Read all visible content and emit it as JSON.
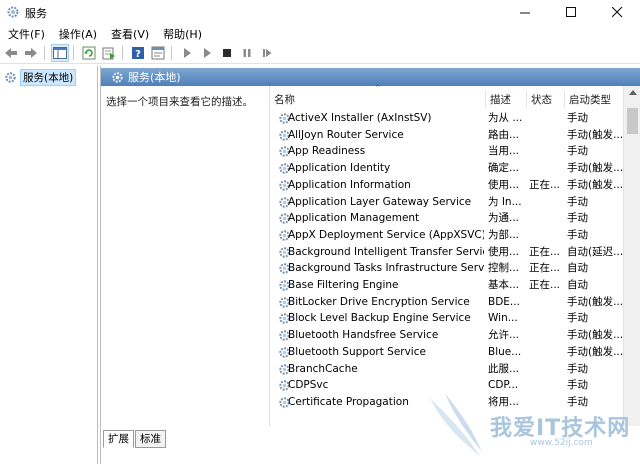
{
  "window": {
    "title": "服务"
  },
  "menu": [
    "文件(F)",
    "操作(A)",
    "查看(V)",
    "帮助(H)"
  ],
  "toolbar": [
    "back-arrow-icon",
    "forward-arrow-icon",
    "sep",
    "show-hide-tree-icon",
    "sep",
    "refresh-icon",
    "export-list-icon",
    "sep",
    "help-icon",
    "properties-icon",
    "sep",
    "play-icon",
    "play-icon",
    "stop-icon",
    "pause-icon",
    "restart-icon"
  ],
  "tree": {
    "root_label": "服务(本地)"
  },
  "main": {
    "header": "服务(本地)",
    "description_prompt": "选择一个项目来查看它的描述。",
    "columns": {
      "name": "名称",
      "description": "描述",
      "status": "状态",
      "startup": "启动类型"
    },
    "rows": [
      {
        "name": "ActiveX Installer (AxInstSV)",
        "desc": "为从 ...",
        "status": "",
        "startup": "手动"
      },
      {
        "name": "AllJoyn Router Service",
        "desc": "路由...",
        "status": "",
        "startup": "手动(触发..."
      },
      {
        "name": "App Readiness",
        "desc": "当用...",
        "status": "",
        "startup": "手动"
      },
      {
        "name": "Application Identity",
        "desc": "确定...",
        "status": "",
        "startup": "手动(触发..."
      },
      {
        "name": "Application Information",
        "desc": "使用...",
        "status": "正在...",
        "startup": "手动(触发..."
      },
      {
        "name": "Application Layer Gateway Service",
        "desc": "为 In...",
        "status": "",
        "startup": "手动"
      },
      {
        "name": "Application Management",
        "desc": "为通...",
        "status": "",
        "startup": "手动"
      },
      {
        "name": "AppX Deployment Service (AppXSVC)",
        "desc": "为部...",
        "status": "",
        "startup": "手动"
      },
      {
        "name": "Background Intelligent Transfer Service",
        "desc": "使用...",
        "status": "正在...",
        "startup": "自动(延迟..."
      },
      {
        "name": "Background Tasks Infrastructure Service",
        "desc": "控制...",
        "status": "正在...",
        "startup": "自动"
      },
      {
        "name": "Base Filtering Engine",
        "desc": "基本...",
        "status": "正在...",
        "startup": "自动"
      },
      {
        "name": "BitLocker Drive Encryption Service",
        "desc": "BDE...",
        "status": "",
        "startup": "手动(触发..."
      },
      {
        "name": "Block Level Backup Engine Service",
        "desc": "Win...",
        "status": "",
        "startup": "手动"
      },
      {
        "name": "Bluetooth Handsfree Service",
        "desc": "允许...",
        "status": "",
        "startup": "手动(触发..."
      },
      {
        "name": "Bluetooth Support Service",
        "desc": "Blue...",
        "status": "",
        "startup": "手动(触发..."
      },
      {
        "name": "BranchCache",
        "desc": "此服...",
        "status": "",
        "startup": "手动"
      },
      {
        "name": "CDPSvc",
        "desc": "CDP...",
        "status": "",
        "startup": "手动"
      },
      {
        "name": "Certificate Propagation",
        "desc": "将用...",
        "status": "",
        "startup": "手动"
      }
    ],
    "tabs": [
      "扩展",
      "标准"
    ]
  },
  "watermark": {
    "text": "我爱IT技术网",
    "url": "www.52ij.com"
  }
}
